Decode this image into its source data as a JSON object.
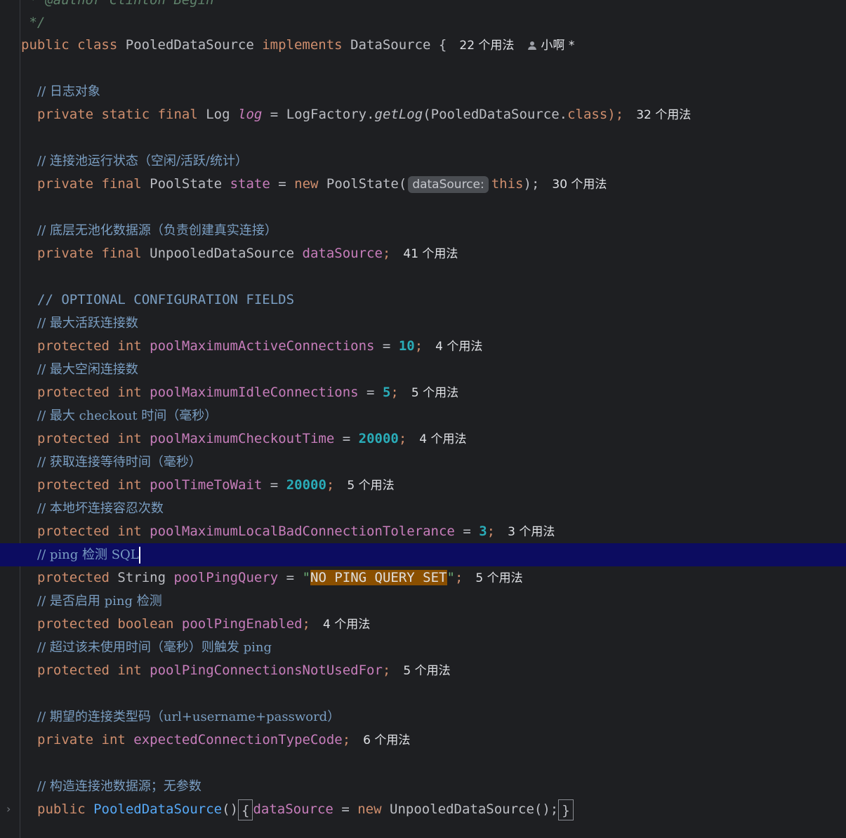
{
  "editor": {
    "doc_author_line": " * @author Clinton Begin",
    "doc_end": " */",
    "class_decl": {
      "public": "public",
      "class": "class",
      "name": "PooledDataSource",
      "implements": "implements",
      "iface": "DataSource",
      "brace": "{",
      "usages": "22 个用法",
      "author": "小啊 *"
    },
    "lines": {
      "c_log": "// 日志对象",
      "log": {
        "mods": "private static final",
        "type": "Log",
        "name": "log",
        "eq": "=",
        "factory": "LogFactory.",
        "method": "getLog",
        "arg": "(PooledDataSource.",
        "cls": "class",
        "end": ");",
        "usages": "32 个用法"
      },
      "c_state": "// 连接池运行状态（空闲/活跃/统计）",
      "state": {
        "mods": "private final",
        "type": "PoolState",
        "name": "state",
        "eq": "=",
        "new": "new",
        "ctor": "PoolState(",
        "hint": "dataSource:",
        "arg": "this",
        "end": ");",
        "usages": "30 个用法"
      },
      "c_ds": "// 底层无池化数据源（负责创建真实连接）",
      "ds": {
        "mods": "private final",
        "type": "UnpooledDataSource",
        "name": "dataSource",
        "end": ";",
        "usages": "41 个用法"
      },
      "c_opt": "// OPTIONAL CONFIGURATION FIELDS",
      "c_maxactive": "// 最大活跃连接数",
      "maxactive": {
        "mods": "protected int",
        "name": "poolMaximumActiveConnections",
        "eq": "=",
        "val": "10",
        "end": ";",
        "usages": "4 个用法"
      },
      "c_maxidle": "// 最大空闲连接数",
      "maxidle": {
        "mods": "protected int",
        "name": "poolMaximumIdleConnections",
        "eq": "=",
        "val": "5",
        "end": ";",
        "usages": "5 个用法"
      },
      "c_checkout": "// 最大 checkout 时间（毫秒）",
      "checkout": {
        "mods": "protected int",
        "name": "poolMaximumCheckoutTime",
        "eq": "=",
        "val": "20000",
        "end": ";",
        "usages": "4 个用法"
      },
      "c_wait": "// 获取连接等待时间（毫秒）",
      "wait": {
        "mods": "protected int",
        "name": "poolTimeToWait",
        "eq": "=",
        "val": "20000",
        "end": ";",
        "usages": "5 个用法"
      },
      "c_bad": "// 本地坏连接容忍次数",
      "bad": {
        "mods": "protected int",
        "name": "poolMaximumLocalBadConnectionTolerance",
        "eq": "=",
        "val": "3",
        "end": ";",
        "usages": "3 个用法"
      },
      "c_ping": "// ping 检测 SQL",
      "pingq": {
        "mods": "protected",
        "type": "String",
        "name": "poolPingQuery",
        "eq": "=",
        "q1": "\"",
        "val": "NO PING QUERY SET",
        "q2": "\"",
        "end": ";",
        "usages": "5 个用法"
      },
      "c_pingen": "// 是否启用 ping 检测",
      "pingen": {
        "mods": "protected boolean",
        "name": "poolPingEnabled",
        "end": ";",
        "usages": "4 个用法"
      },
      "c_pingnu": "// 超过该未使用时间（毫秒）则触发 ping",
      "pingnu": {
        "mods": "protected int",
        "name": "poolPingConnectionsNotUsedFor",
        "end": ";",
        "usages": "5 个用法"
      },
      "c_code": "// 期望的连接类型码（url+username+password）",
      "code": {
        "mods": "private int",
        "name": "expectedConnectionTypeCode",
        "end": ";",
        "usages": "6 个用法"
      },
      "c_ctor": "// 构造连接池数据源；无参数",
      "ctor": {
        "mod": "public",
        "name": "PooledDataSource",
        "parens": "()",
        "lbrace": "{",
        "field": "dataSource",
        "eq": "=",
        "new": "new",
        "call": "UnpooledDataSource();",
        "rbrace": "}"
      }
    }
  },
  "colors": {
    "background": "#1e1f22",
    "keyword": "#cf8e6d",
    "field": "#c77dbb",
    "number": "#2aacb8",
    "comment": "#7a9ec2",
    "current_line": "#0c0c60"
  }
}
